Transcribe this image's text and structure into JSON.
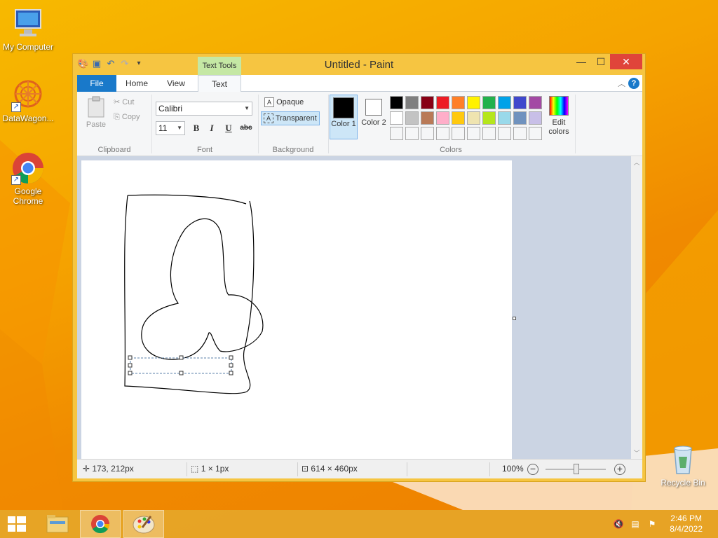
{
  "desktop": {
    "icons": [
      {
        "label": "My Computer"
      },
      {
        "label": "DataWagon..."
      },
      {
        "label": "Google Chrome"
      },
      {
        "label": "Recycle Bin"
      }
    ]
  },
  "window": {
    "title": "Untitled - Paint",
    "context_tab": "Text Tools",
    "tabs": [
      {
        "label": "File"
      },
      {
        "label": "Home"
      },
      {
        "label": "View"
      },
      {
        "label": "Text"
      }
    ],
    "controls": {
      "minimize": "—",
      "maximize": "☐",
      "close": "✕"
    }
  },
  "ribbon": {
    "clipboard": {
      "label": "Clipboard",
      "paste": "Paste",
      "cut": "Cut",
      "copy": "Copy"
    },
    "font": {
      "label": "Font",
      "family": "Calibri",
      "size": "11",
      "bold": "B",
      "italic": "I",
      "underline": "U",
      "strike": "abc"
    },
    "background": {
      "label": "Background",
      "opaque": "Opaque",
      "transparent": "Transparent"
    },
    "colors": {
      "label": "Colors",
      "color1": "Color 1",
      "color2": "Color 2",
      "edit": "Edit colors",
      "color1_value": "#000000",
      "color2_value": "#ffffff",
      "palette_row1": [
        "#000000",
        "#7f7f7f",
        "#880015",
        "#ed1c24",
        "#ff7f27",
        "#fff200",
        "#22b14c",
        "#00a2e8",
        "#3f48cc",
        "#a349a4"
      ],
      "palette_row2": [
        "#ffffff",
        "#c3c3c3",
        "#b97a57",
        "#ffaec9",
        "#ffc90e",
        "#efe4b0",
        "#b5e61d",
        "#99d9ea",
        "#7092be",
        "#c8bfe7"
      ]
    }
  },
  "status": {
    "cursor_pos": "173, 212px",
    "selection_size": "1 × 1px",
    "image_size": "614 × 460px",
    "zoom": "100%"
  },
  "taskbar": {
    "time": "2:46 PM",
    "date": "8/4/2022"
  }
}
